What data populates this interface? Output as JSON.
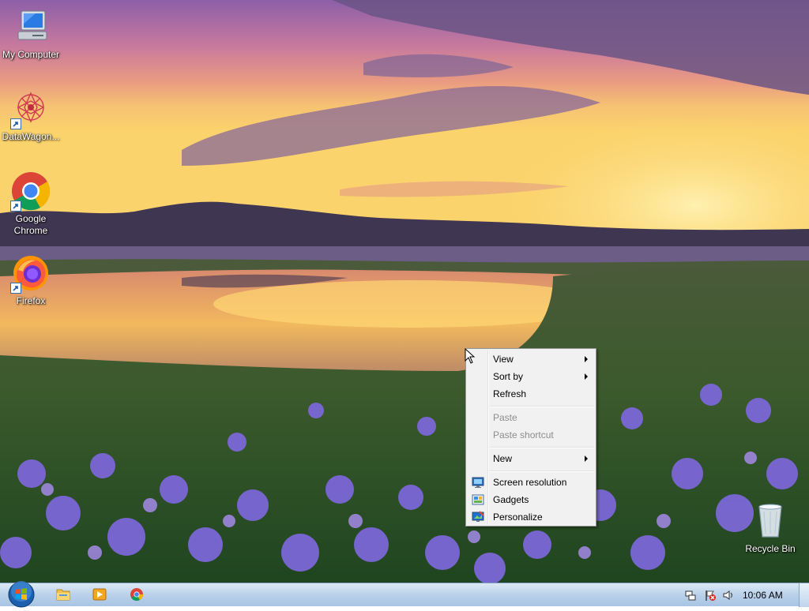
{
  "desktop": {
    "icons": [
      {
        "label": "My Computer",
        "icon": "my-computer-icon"
      },
      {
        "label": "DataWagon...",
        "icon": "datawagon-icon"
      },
      {
        "label": "Google Chrome",
        "icon": "chrome-icon"
      },
      {
        "label": "Firefox",
        "icon": "firefox-icon"
      },
      {
        "label": "Recycle Bin",
        "icon": "recycle-bin-icon"
      }
    ]
  },
  "context_menu": {
    "view": "View",
    "sort_by": "Sort by",
    "refresh": "Refresh",
    "paste": "Paste",
    "paste_shortcut": "Paste shortcut",
    "new": "New",
    "screen_resolution": "Screen resolution",
    "gadgets": "Gadgets",
    "personalize": "Personalize"
  },
  "taskbar": {
    "clock": "10:06 AM",
    "pinned": [
      "start-orb-icon",
      "explorer-icon",
      "media-player-icon",
      "chrome-icon"
    ],
    "tray": [
      "network-icon",
      "action-center-flag-icon",
      "volume-icon"
    ]
  },
  "colors": {
    "menu_bg": "#f1f1f1",
    "taskbar_bg": "#b9d1ea",
    "disabled_text": "#8d8d8d"
  }
}
